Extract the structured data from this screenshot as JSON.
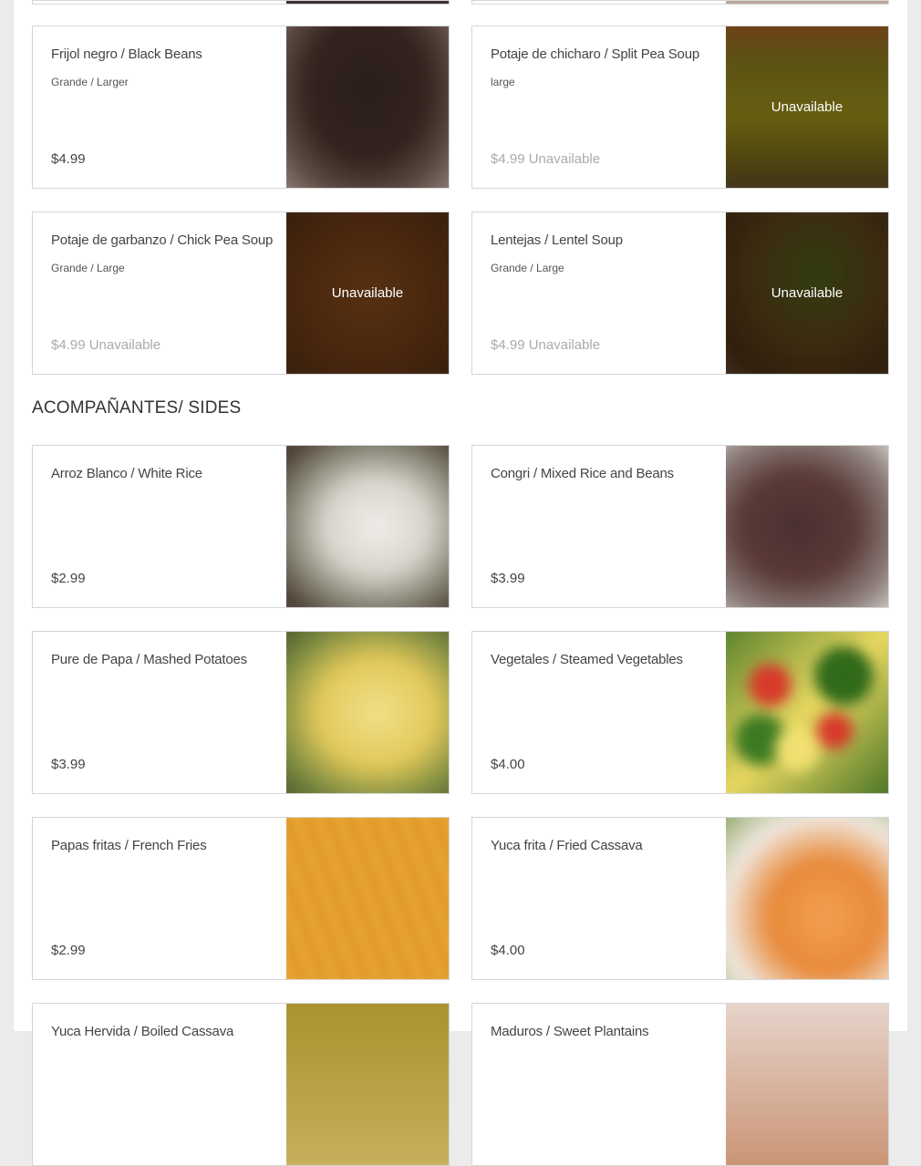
{
  "section_sides": {
    "title": "ACOMPAÑANTES/ SIDES"
  },
  "items": [
    {
      "name": "Frijol negro / Black Beans",
      "desc": "Grande / Larger",
      "price": "$4.99",
      "unavailable": false,
      "image": "black-beans-icon"
    },
    {
      "name": "Potaje de chicharo / Split Pea Soup",
      "desc": "large",
      "price": "$4.99 Unavailable",
      "unavailable": true,
      "overlay": "Unavailable",
      "image": "split-pea-soup-icon"
    },
    {
      "name": "Potaje de garbanzo / Chick Pea Soup",
      "desc": "Grande / Large",
      "price": "$4.99 Unavailable",
      "unavailable": true,
      "overlay": "Unavailable",
      "image": "chick-pea-soup-icon"
    },
    {
      "name": "Lentejas / Lentel Soup",
      "desc": "Grande / Large",
      "price": "$4.99 Unavailable",
      "unavailable": true,
      "overlay": "Unavailable",
      "image": "lentil-soup-icon"
    },
    {
      "name": "Arroz Blanco / White Rice",
      "desc": "",
      "price": "$2.99",
      "unavailable": false,
      "image": "white-rice-icon"
    },
    {
      "name": "Congri / Mixed Rice and Beans",
      "desc": "",
      "price": "$3.99",
      "unavailable": false,
      "image": "congri-icon"
    },
    {
      "name": "Pure de Papa / Mashed Potatoes",
      "desc": "",
      "price": "$3.99",
      "unavailable": false,
      "image": "mashed-potatoes-icon"
    },
    {
      "name": "Vegetales / Steamed Vegetables",
      "desc": "",
      "price": "$4.00",
      "unavailable": false,
      "image": "steamed-vegetables-icon"
    },
    {
      "name": "Papas fritas / French Fries",
      "desc": "",
      "price": "$2.99",
      "unavailable": false,
      "image": "french-fries-icon"
    },
    {
      "name": "Yuca frita / Fried Cassava",
      "desc": "",
      "price": "$4.00",
      "unavailable": false,
      "image": "fried-cassava-icon"
    },
    {
      "name": "Yuca Hervida / Boiled Cassava",
      "desc": "",
      "price": "",
      "unavailable": false,
      "image": "boiled-cassava-icon"
    },
    {
      "name": "Maduros / Sweet Plantains",
      "desc": "",
      "price": "",
      "unavailable": false,
      "image": "sweet-plantains-icon"
    }
  ]
}
